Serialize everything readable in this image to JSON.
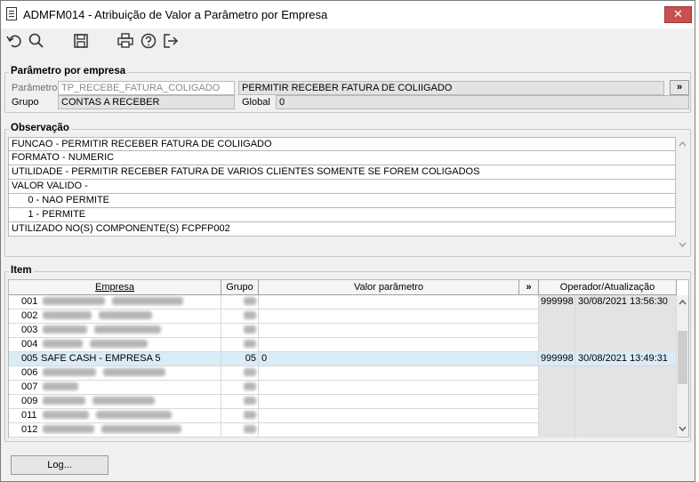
{
  "window": {
    "title": "ADMFM014 - Atribuição de Valor a Parâmetro por Empresa",
    "close_glyph": "✕"
  },
  "toolbar": {
    "icons": [
      "undo-icon",
      "search-icon",
      "save-icon",
      "print-icon",
      "help-icon",
      "exit-icon"
    ]
  },
  "param_group": {
    "legend": "Parâmetro por empresa",
    "parametro_label": "Parâmetro",
    "parametro_code": "TP_RECEBE_FATURA_COLIGADO",
    "parametro_desc": "PERMITIR RECEBER FATURA DE COLIIGADO",
    "expand_label": "»",
    "grupo_label": "Grupo",
    "grupo_value": "CONTAS A RECEBER",
    "global_label": "Global",
    "global_value": "0"
  },
  "obs_group": {
    "legend": "Observação",
    "lines": [
      "FUNCAO - PERMITIR RECEBER FATURA DE COLIIGADO",
      "FORMATO - NUMERIC",
      "UTILIDADE - PERMITIR RECEBER FATURA DE VARIOS CLIENTES SOMENTE SE FOREM COLIGADOS",
      "VALOR VALIDO -",
      "      0 - NAO PERMITE",
      "      1 - PERMITE",
      "UTILIZADO NO(S) COMPONENTE(S) FCPFP002"
    ]
  },
  "item_group": {
    "legend": "Item",
    "columns": {
      "empresa": "Empresa",
      "grupo": "Grupo",
      "valor": "Valor parâmetro",
      "expand": "»",
      "operador": "Operador/Atualização"
    },
    "rows": [
      {
        "code": "001",
        "empresa": "",
        "grupo": "",
        "valor": "",
        "operador": "999998",
        "data": "30/08/2021 13:56:30"
      },
      {
        "code": "002",
        "empresa": "",
        "grupo": "",
        "valor": "",
        "operador": "",
        "data": ""
      },
      {
        "code": "003",
        "empresa": "",
        "grupo": "",
        "valor": "",
        "operador": "",
        "data": ""
      },
      {
        "code": "004",
        "empresa": "",
        "grupo": "",
        "valor": "",
        "operador": "",
        "data": ""
      },
      {
        "code": "005",
        "empresa": "SAFE CASH -  EMPRESA 5",
        "grupo": "05",
        "valor": "0",
        "operador": "999998",
        "data": "30/08/2021 13:49:31"
      },
      {
        "code": "006",
        "empresa": "",
        "grupo": "",
        "valor": "",
        "operador": "",
        "data": ""
      },
      {
        "code": "007",
        "empresa": "",
        "grupo": "",
        "valor": "",
        "operador": "",
        "data": ""
      },
      {
        "code": "009",
        "empresa": "",
        "grupo": "",
        "valor": "",
        "operador": "",
        "data": ""
      },
      {
        "code": "011",
        "empresa": "",
        "grupo": "",
        "valor": "",
        "operador": "",
        "data": ""
      },
      {
        "code": "012",
        "empresa": "",
        "grupo": "",
        "valor": "",
        "operador": "",
        "data": ""
      }
    ],
    "selected_row": "005"
  },
  "footer": {
    "log_button": "Log..."
  }
}
